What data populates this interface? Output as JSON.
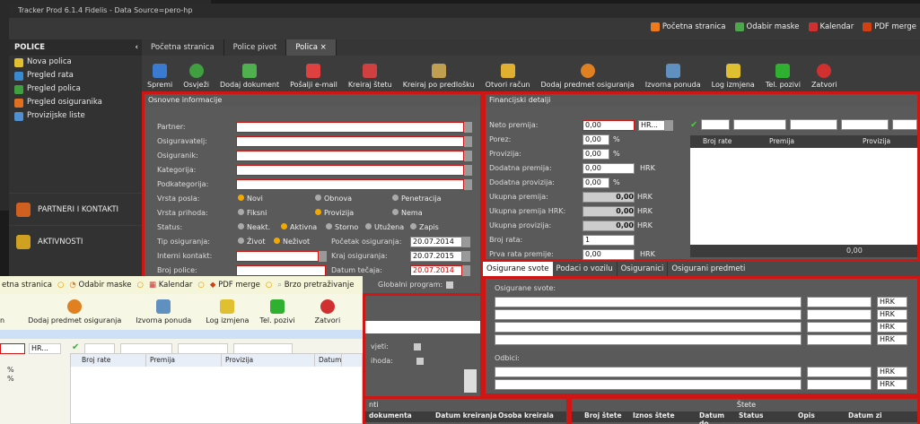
{
  "window": {
    "title": "Tracker Prod 6.1.4 Fidelis - Data Source=pero-hp"
  },
  "topnav": [
    {
      "label": "Početna stranica",
      "icon": "home-icon",
      "color": "#f07a1a"
    },
    {
      "label": "Odabir maske",
      "icon": "rainbow-icon",
      "color": "#4ca64c"
    },
    {
      "label": "Kalendar",
      "icon": "calendar-icon",
      "color": "#d03030"
    },
    {
      "label": "PDF merge",
      "icon": "pdf-icon",
      "color": "#d04010"
    }
  ],
  "sidebar": {
    "header": "POLICE",
    "items": [
      {
        "label": "Nova polica",
        "icon": "new-policy-icon",
        "color": "#e0c030"
      },
      {
        "label": "Pregled rata",
        "icon": "rates-icon",
        "color": "#3a8ad0"
      },
      {
        "label": "Pregled polica",
        "icon": "policies-icon",
        "color": "#40a040"
      },
      {
        "label": "Pregled osiguranika",
        "icon": "insured-icon",
        "color": "#e07020"
      },
      {
        "label": "Provizijske liste",
        "icon": "commission-icon",
        "color": "#5090d0"
      }
    ],
    "big_items": [
      {
        "label": "PARTNERI I KONTAKTI",
        "icon": "partners-icon",
        "color": "#d06020"
      },
      {
        "label": "AKTIVNOSTI",
        "icon": "activities-icon",
        "color": "#d0a020"
      }
    ]
  },
  "tabs": [
    {
      "label": "Početna stranica"
    },
    {
      "label": "Police pivot"
    },
    {
      "label": "Polica",
      "close": "×"
    }
  ],
  "toolbar": [
    {
      "label": "Spremi",
      "icon": "save-icon",
      "color": "#3a7ad0"
    },
    {
      "label": "Osvježi",
      "icon": "refresh-icon",
      "color": "#40a040"
    },
    {
      "label": "Dodaj dokument",
      "icon": "add-document-icon",
      "color": "#50b050"
    },
    {
      "label": "Pošalji e-mail",
      "icon": "email-icon",
      "color": "#e04040"
    },
    {
      "label": "Kreiraj štetu",
      "icon": "damage-icon",
      "color": "#d04040"
    },
    {
      "label": "Kreiraj po predlošku",
      "icon": "template-icon",
      "color": "#c0a050"
    },
    {
      "label": "Otvori račun",
      "icon": "folder-icon",
      "color": "#e0b030"
    },
    {
      "label": "Dodaj predmet osiguranja",
      "icon": "add-item-icon",
      "color": "#e08020"
    },
    {
      "label": "Izvorna ponuda",
      "icon": "offer-icon",
      "color": "#6090c0"
    },
    {
      "label": "Log izmjena",
      "icon": "log-icon",
      "color": "#e0c030"
    },
    {
      "label": "Tel. pozivi",
      "icon": "phone-icon",
      "color": "#30b030"
    },
    {
      "label": "Zatvori",
      "icon": "close-icon",
      "color": "#d03030"
    }
  ],
  "basic": {
    "title": "Osnovne informacije",
    "labels": {
      "partner": "Partner:",
      "insurer": "Osiguravatelj:",
      "insured": "Osiguranik:",
      "category": "Kategorija:",
      "subcategory": "Podkategorija:",
      "job_type": "Vrsta posla:",
      "income_type": "Vrsta prihoda:",
      "status": "Status:",
      "ins_type": "Tip osiguranja:",
      "internal": "Interni kontakt:",
      "policy_no": "Broj police:"
    },
    "job_options": [
      "Novi",
      "Obnova",
      "Penetracija"
    ],
    "income_options": [
      "Fiksni",
      "Provizija",
      "Nema"
    ],
    "status_options": [
      "Neakt.",
      "Aktivna",
      "Storno",
      "Utužena",
      "Zapis"
    ],
    "ins_type_options": [
      "Život",
      "Neživot"
    ],
    "start_label": "Početak osiguranja:",
    "start_value": "20.07.2014",
    "end_label": "Kraj osiguranja:",
    "end_value": "20.07.2015",
    "rate_label": "Datum tečaja:",
    "rate_value": "20.07.2014",
    "global_label": "Globalni program:"
  },
  "financial": {
    "title": "Financijski detalji",
    "rows": [
      {
        "label": "Neto premija:",
        "value": "0,00",
        "unit": "HR..."
      },
      {
        "label": "Porez:",
        "value": "0,00",
        "unit": "%"
      },
      {
        "label": "Provizija:",
        "value": "0,00",
        "unit": "%"
      },
      {
        "label": "Dodatna premija:",
        "value": "0,00",
        "unit": "HRK"
      },
      {
        "label": "Dodatna provizija:",
        "value": "0,00",
        "unit": "%"
      },
      {
        "label": "Ukupna premija:",
        "value": "0,00",
        "unit": "HRK"
      },
      {
        "label": "Ukupna premija HRK:",
        "value": "0,00",
        "unit": "HRK"
      },
      {
        "label": "Ukupna provizija:",
        "value": "0,00",
        "unit": "HRK"
      },
      {
        "label": "Broj rata:",
        "value": "1",
        "unit": ""
      },
      {
        "label": "Prva rata premije:",
        "value": "0,00",
        "unit": "HRK"
      }
    ],
    "grid_headers": [
      "Broj rate",
      "Premija",
      "Provizija"
    ],
    "grid_total": "0,00"
  },
  "lower_tabs": [
    "Osigurane svote",
    "Podaci o vozilu",
    "Osiguranici",
    "Osigurani predmeti"
  ],
  "sums": {
    "title": "Osigurane svote:",
    "deductions": "Odbici:",
    "currency": "HRK"
  },
  "mid": {
    "conditions": "vjeti:",
    "income": "ihoda:"
  },
  "bottom": {
    "docs_title": "nti",
    "docs_headers": [
      "dokumenta",
      "Datum kreiranja",
      "Osoba kreirala"
    ],
    "damages_title": "Štete",
    "damages_headers": [
      "Broj štete",
      "Iznos štete",
      "Datum do...",
      "Status",
      "Opis",
      "Datum zi"
    ]
  },
  "overlay": {
    "nav": [
      "etna stranica",
      "Odabir maske",
      "Kalendar",
      "PDF merge",
      "Brzo pretraživanje"
    ],
    "toolbar": [
      "n",
      "Dodaj predmet osiguranja",
      "Izvorna ponuda",
      "Log izmjena",
      "Tel. pozivi",
      "Zatvori"
    ],
    "currency": "HR...",
    "grid_headers": [
      "Broj rate",
      "Premija",
      "Provizija",
      "Datum"
    ],
    "pct": "%"
  }
}
